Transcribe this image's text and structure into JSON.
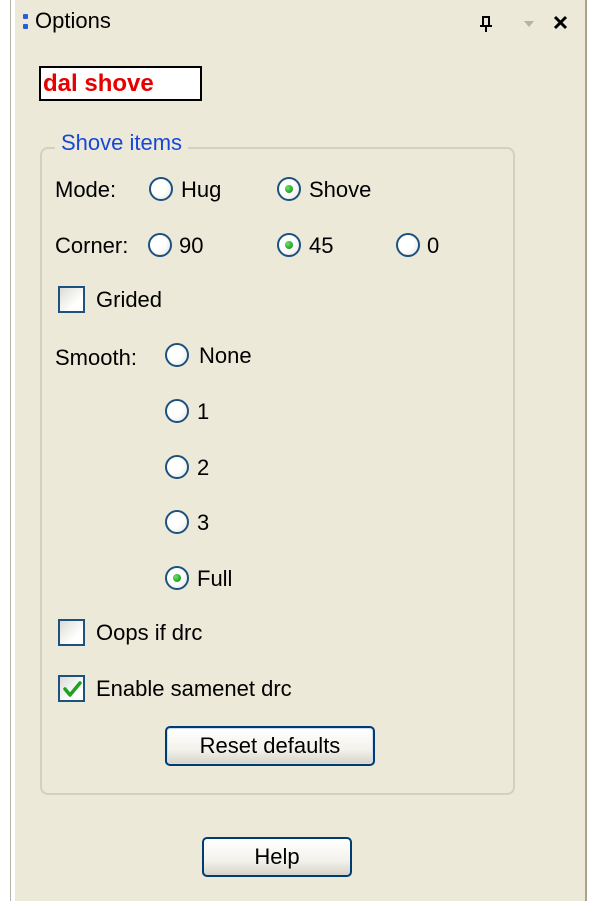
{
  "panel": {
    "title": "Options"
  },
  "tool_name": "dal shove",
  "shove_items": {
    "legend": "Shove items",
    "mode": {
      "label": "Mode:",
      "options": [
        {
          "label": "Hug",
          "checked": false
        },
        {
          "label": "Shove",
          "checked": true
        }
      ]
    },
    "corner": {
      "label": "Corner:",
      "options": [
        {
          "label": "90",
          "checked": false
        },
        {
          "label": "45",
          "checked": true
        },
        {
          "label": "0",
          "checked": false
        }
      ]
    },
    "grided": {
      "label": "Grided",
      "checked": false
    },
    "smooth": {
      "label": "Smooth:",
      "options": [
        {
          "label": "None",
          "checked": false
        },
        {
          "label": "1",
          "checked": false
        },
        {
          "label": "2",
          "checked": false
        },
        {
          "label": "3",
          "checked": false
        },
        {
          "label": "Full",
          "checked": true
        }
      ]
    },
    "oops_if_drc": {
      "label": "Oops if drc",
      "checked": false
    },
    "enable_samenet_drc": {
      "label": "Enable samenet drc",
      "checked": true
    },
    "reset_defaults_label": "Reset defaults"
  },
  "help_label": "Help",
  "colors": {
    "background": "#ece9d8",
    "tool_name_text": "#e60000",
    "legend_text": "#1847d8",
    "radio_selected": "#21a121"
  }
}
